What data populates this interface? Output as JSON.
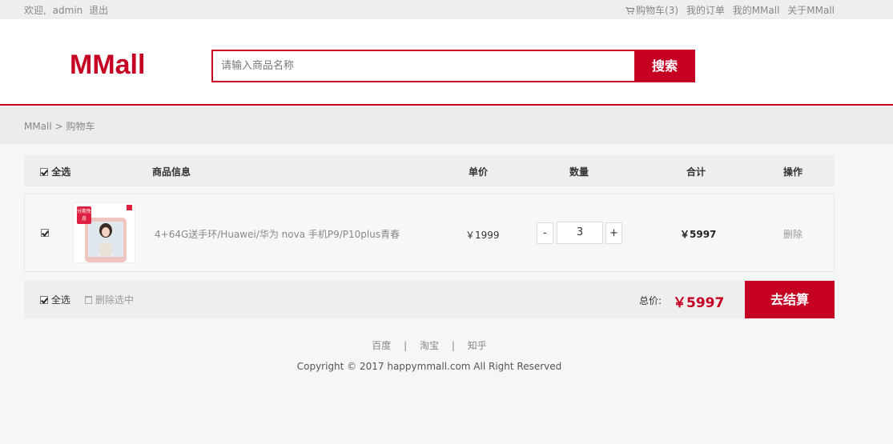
{
  "topbar": {
    "welcome": "欢迎,",
    "username": "admin",
    "logout": "退出",
    "cart_link": "购物车(3)",
    "orders_link": "我的订单",
    "mymall_link": "我的MMall",
    "about_link": "关于MMall"
  },
  "header": {
    "logo": "MMall",
    "search_placeholder": "请输入商品名称",
    "search_button": "搜索"
  },
  "breadcrumb": {
    "home": "MMall",
    "separator": ">",
    "current": "购物车"
  },
  "table": {
    "select_all": "全选",
    "col_info": "商品信息",
    "col_price": "单价",
    "col_qty": "数量",
    "col_total": "合计",
    "col_action": "操作"
  },
  "items": [
    {
      "checked": true,
      "thumb_tag": "分期免息",
      "name": "4+64G送手环/Huawei/华为 nova 手机P9/P10plus青春",
      "price": "￥1999",
      "qty_minus": "-",
      "qty": "3",
      "qty_plus": "+",
      "subtotal": "￥5997",
      "delete": "删除"
    }
  ],
  "footer_bar": {
    "select_all": "全选",
    "delete_selected": "删除选中",
    "total_label": "总价:",
    "total_value": "￥5997",
    "checkout": "去结算"
  },
  "footer": {
    "links": [
      "百度",
      "淘宝",
      "知乎"
    ],
    "separator": "|",
    "copyright": "Copyright © 2017 happymmall.com All Right Reserved"
  },
  "colors": {
    "brand": "#c60023",
    "topbar_bg": "#eeeeee",
    "page_bg": "#f6f6f6"
  }
}
